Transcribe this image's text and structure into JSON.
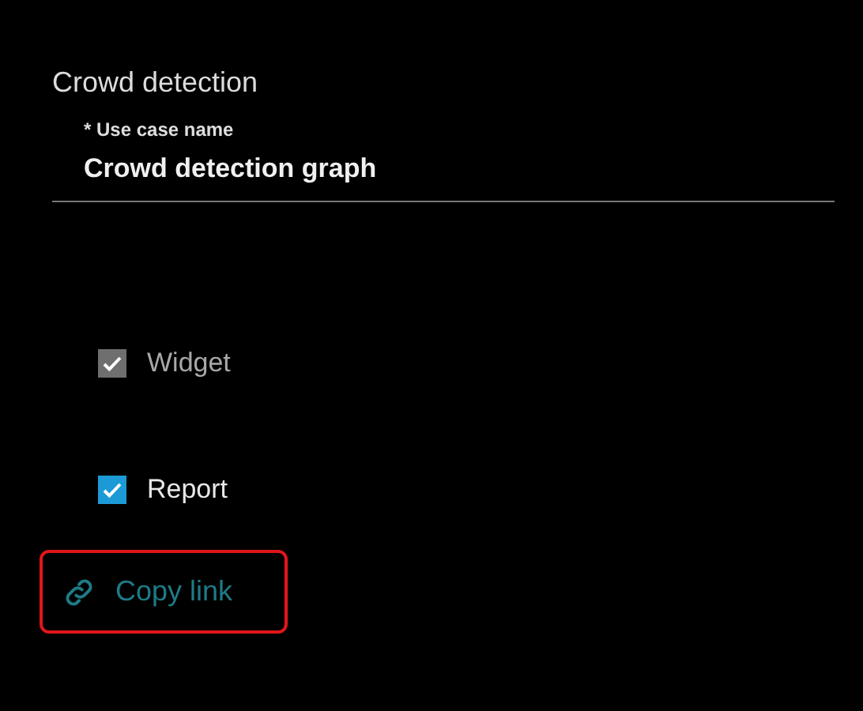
{
  "title": "Crowd detection",
  "field": {
    "label": "* Use case name",
    "value": "Crowd detection graph"
  },
  "options": [
    {
      "label": "Widget",
      "checked": true,
      "disabled": true
    },
    {
      "label": "Report",
      "checked": true,
      "disabled": false
    }
  ],
  "copy_link": {
    "label": "Copy link",
    "highlighted": true
  }
}
